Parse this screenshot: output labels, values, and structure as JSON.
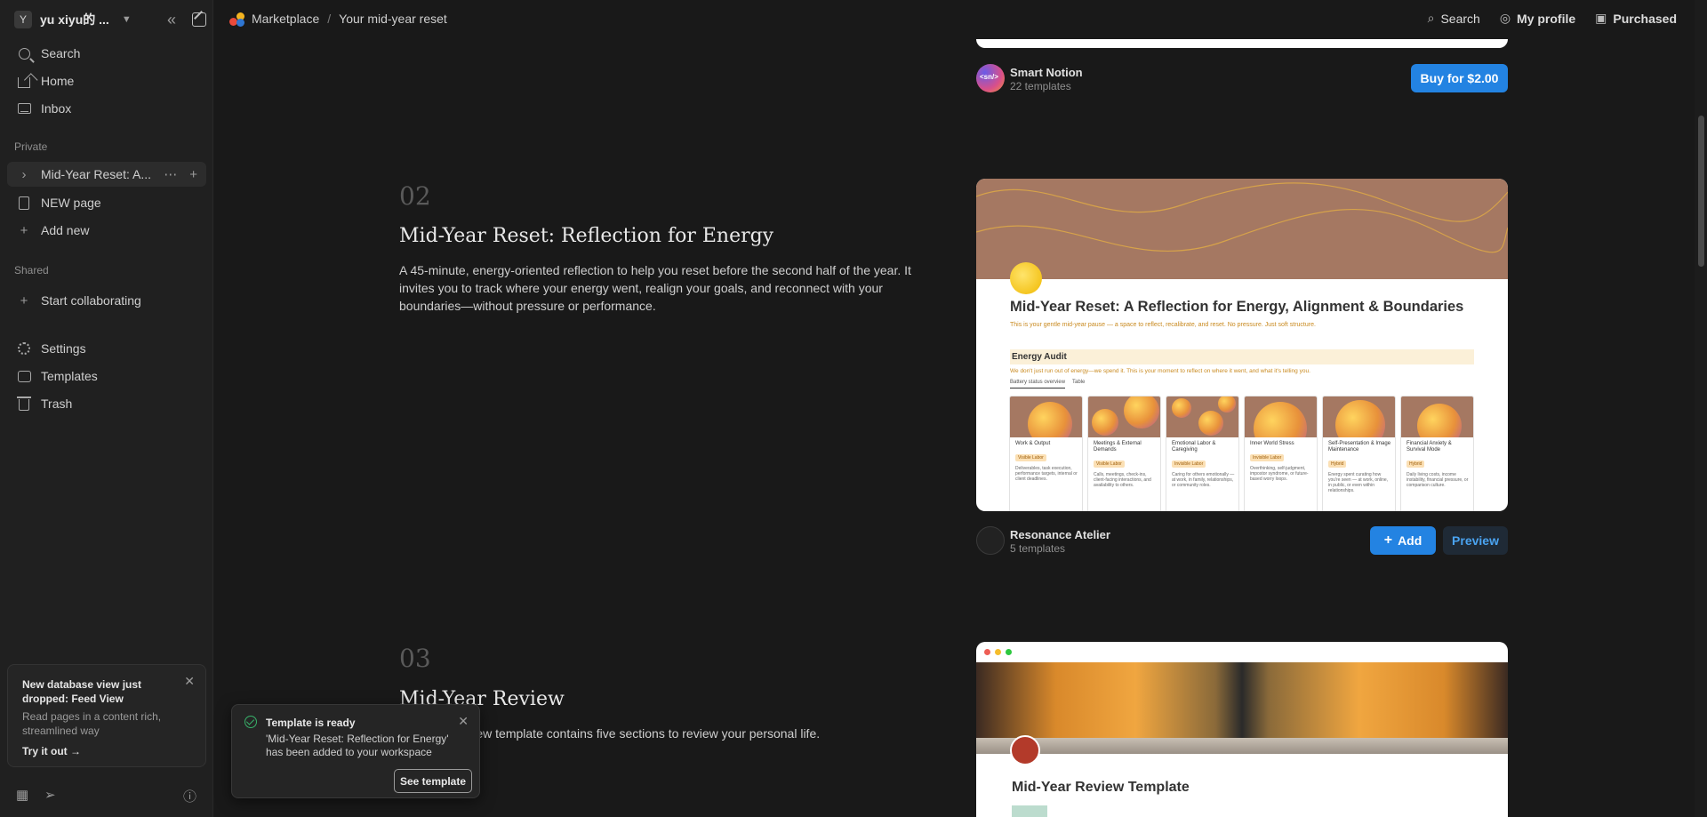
{
  "workspace": {
    "avatar": "Y",
    "name": "yu xiyu的 ..."
  },
  "sidebar": {
    "top": [
      {
        "label": "Search",
        "icon": "search-icon"
      },
      {
        "label": "Home",
        "icon": "home-icon"
      },
      {
        "label": "Inbox",
        "icon": "inbox-icon"
      }
    ],
    "private_label": "Private",
    "private": [
      {
        "label": "Mid-Year Reset: A...",
        "icon": "chevron-right-icon"
      },
      {
        "label": "NEW page",
        "icon": "page-icon"
      },
      {
        "label": "Add new",
        "icon": "plus-icon"
      }
    ],
    "shared_label": "Shared",
    "shared": [
      {
        "label": "Start collaborating",
        "icon": "plus-icon"
      }
    ],
    "bottom": [
      {
        "label": "Settings",
        "icon": "gear-icon"
      },
      {
        "label": "Templates",
        "icon": "templates-icon"
      },
      {
        "label": "Trash",
        "icon": "trash-icon"
      }
    ],
    "notice": {
      "title": "New database view just dropped: Feed View",
      "text": "Read pages in a content rich, streamlined way",
      "link": "Try it out →"
    }
  },
  "topbar": {
    "breadcrumb": [
      "Marketplace",
      "Your mid-year reset"
    ],
    "search": "Search",
    "profile": "My profile",
    "purchased": "Purchased"
  },
  "section1": {
    "creator": "Smart Notion",
    "count": "22 templates",
    "avatar_text": "<sn/>",
    "buy": "Buy for $2.00"
  },
  "section2": {
    "num": "02",
    "title": "Mid-Year Reset: Reflection for Energy",
    "desc": "A 45-minute, energy-oriented reflection to help you reset before the second half of the year. It invites you to track where your energy went, realign your goals, and reconnect with your boundaries—without pressure or performance.",
    "preview": {
      "title": "Mid-Year Reset: A Reflection for Energy, Alignment & Boundaries",
      "subtitle": "This is your gentle mid-year pause — a space to reflect, recalibrate, and reset. No pressure. Just soft structure.",
      "audit": "Energy Audit",
      "audit_sub": "We don't just run out of energy—we spend it. This is your moment to reflect on where it went, and what it's telling you.",
      "tabs": [
        "Battery status overview",
        "Table"
      ],
      "cards": [
        {
          "label": "Work & Output",
          "tag": "Visible Labor",
          "text": "Deliverables, task execution, performance targets, internal or client deadlines."
        },
        {
          "label": "Meetings & External Demands",
          "tag": "Visible Labor",
          "text": "Calls, meetings, check-ins, client-facing interactions, and availability to others."
        },
        {
          "label": "Emotional Labor & Caregiving",
          "tag": "Invisible Labor",
          "text": "Caring for others emotionally — at work, in family, relationships, or community roles."
        },
        {
          "label": "Inner World Stress",
          "tag": "Invisible Labor",
          "text": "Overthinking, self-judgment, impostor syndrome, or future-based worry loops."
        },
        {
          "label": "Self-Presentation & Image Maintenance",
          "tag": "Hybrid",
          "text": "Energy spent curating how you're seen — at work, online, in public, or even within relationships."
        },
        {
          "label": "Financial Anxiety & Survival Mode",
          "tag": "Hybrid",
          "text": "Daily living costs, income instability, financial pressure, or comparison culture."
        }
      ]
    },
    "creator": "Resonance Atelier",
    "count": "5 templates",
    "add": "Add",
    "preview_btn": "Preview"
  },
  "section3": {
    "num": "03",
    "title": "Mid-Year Review",
    "desc": "Mid Year Review template contains five sections to review your personal life.",
    "preview_title": "Mid-Year Review Template"
  },
  "toast": {
    "title": "Template is ready",
    "body": "'Mid-Year Reset: Reflection for Energy' has been added to your workspace",
    "button": "See template"
  },
  "colors": {
    "accent": "#2383e2",
    "success": "#38b26a",
    "banner": "#a57862"
  }
}
